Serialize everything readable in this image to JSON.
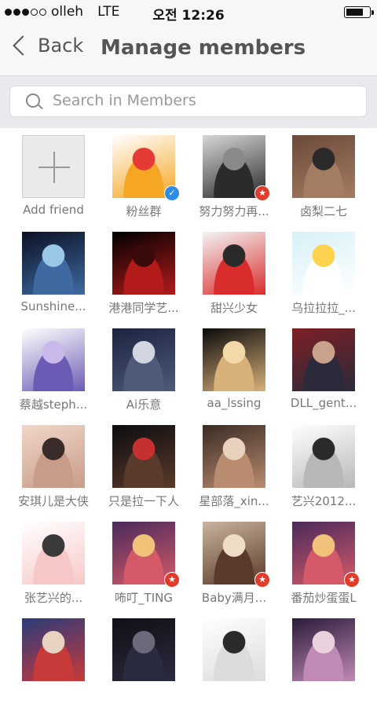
{
  "status": {
    "carrier": "olleh",
    "network": "LTE",
    "time": "오전 12:26",
    "battery_level": 0.8
  },
  "nav": {
    "back_label": "Back",
    "title": "Manage members"
  },
  "search": {
    "placeholder": "Search in Members"
  },
  "members": [
    {
      "name": "Add friend",
      "type": "add"
    },
    {
      "name": "粉丝群",
      "badge": "verified",
      "colors": [
        "#ffffff",
        "#f5a623",
        "#e53935"
      ]
    },
    {
      "name": "努力努力再...",
      "badge": "star",
      "colors": [
        "#d7d7d7",
        "#2b2b2b",
        "#8a8a8a"
      ]
    },
    {
      "name": "卤梨二七",
      "colors": [
        "#6b4a3a",
        "#a47c62",
        "#2a2a2a"
      ]
    },
    {
      "name": "Sunshine...",
      "colors": [
        "#0b1024",
        "#3f6aa1",
        "#9ac6e8"
      ]
    },
    {
      "name": "港港同学艺...",
      "colors": [
        "#000000",
        "#b31b1b",
        "#3b0a0a"
      ]
    },
    {
      "name": "甜兴少女",
      "colors": [
        "#f3f3f3",
        "#d92d2d",
        "#2a2a2a"
      ]
    },
    {
      "name": "乌拉拉拉_...",
      "colors": [
        "#d7f1f7",
        "#ffffff",
        "#ffd34d"
      ]
    },
    {
      "name": "蔡越steph...",
      "colors": [
        "#ffffff",
        "#6c5bb4",
        "#c9b8ea"
      ]
    },
    {
      "name": "Ai乐意",
      "colors": [
        "#1b2340",
        "#4e5a7a",
        "#d2d6e0"
      ]
    },
    {
      "name": "aa_lssing",
      "colors": [
        "#0a0a0a",
        "#d8b07a",
        "#f3d9a8"
      ]
    },
    {
      "name": "DLL_gent...",
      "colors": [
        "#7e1f25",
        "#2a2a3a",
        "#c9a28b"
      ]
    },
    {
      "name": "安琪儿是大侠",
      "colors": [
        "#f0d6c8",
        "#c99c8a",
        "#3a2c2a"
      ]
    },
    {
      "name": "只是拉一下人",
      "colors": [
        "#0c0c10",
        "#5a3a2a",
        "#c73030"
      ]
    },
    {
      "name": "星部落_xin...",
      "colors": [
        "#3a2b24",
        "#b98c70",
        "#e9d2bd"
      ]
    },
    {
      "name": "艺兴2012...",
      "colors": [
        "#ffffff",
        "#b8b8b8",
        "#2a2a2a"
      ]
    },
    {
      "name": "张艺兴的...",
      "colors": [
        "#ffffff",
        "#f8c8c8",
        "#3a3a3a"
      ]
    },
    {
      "name": "咘叮_TING",
      "badge": "star",
      "colors": [
        "#4a2a5a",
        "#d45a6a",
        "#f1c27a"
      ]
    },
    {
      "name": "Baby满月...",
      "badge": "star",
      "colors": [
        "#c9b49e",
        "#5a3a2a",
        "#f0ddc8"
      ]
    },
    {
      "name": "番茄炒蛋蛋L",
      "badge": "star",
      "colors": [
        "#4a2a5a",
        "#d45a6a",
        "#f1c27a"
      ]
    },
    {
      "name": "",
      "colors": [
        "#2b3b7a",
        "#c73a3a",
        "#e8d2c2"
      ]
    },
    {
      "name": "",
      "colors": [
        "#0f0f14",
        "#2b2b40",
        "#6a6a7a"
      ]
    },
    {
      "name": "",
      "colors": [
        "#ffffff",
        "#dcdcdc",
        "#2a2a2a"
      ]
    },
    {
      "name": "",
      "colors": [
        "#2a1b3a",
        "#c08ab4",
        "#e9d2de"
      ]
    }
  ]
}
